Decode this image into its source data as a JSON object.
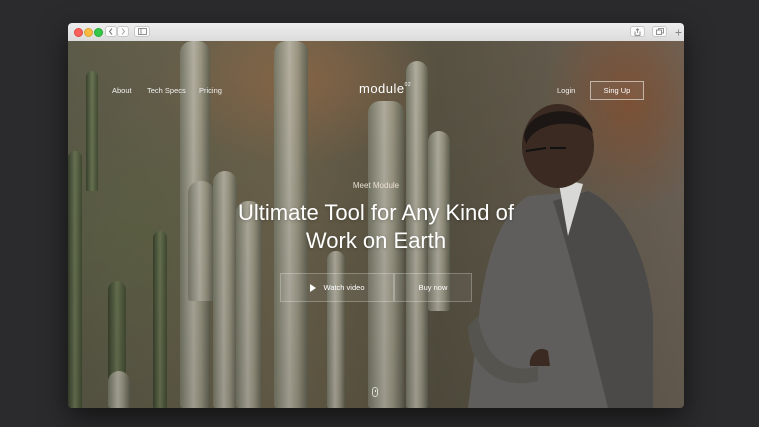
{
  "nav": {
    "links": [
      "About",
      "Tech Specs",
      "Pricing"
    ],
    "brand": "module",
    "brand_sup": "02",
    "login": "Login",
    "signup": "Sing Up"
  },
  "hero": {
    "eyebrow": "Meet Module",
    "headline": "Ultimate Tool for Any Kind of Work on Earth",
    "watch_video": "Watch video",
    "buy_now": "Buy now"
  },
  "browser": {
    "icons": [
      "close-dot",
      "minimize-dot",
      "maximize-dot",
      "back-arrow-icon",
      "forward-arrow-icon",
      "sidebar-icon",
      "share-icon",
      "tabs-icon",
      "plus-icon"
    ]
  }
}
